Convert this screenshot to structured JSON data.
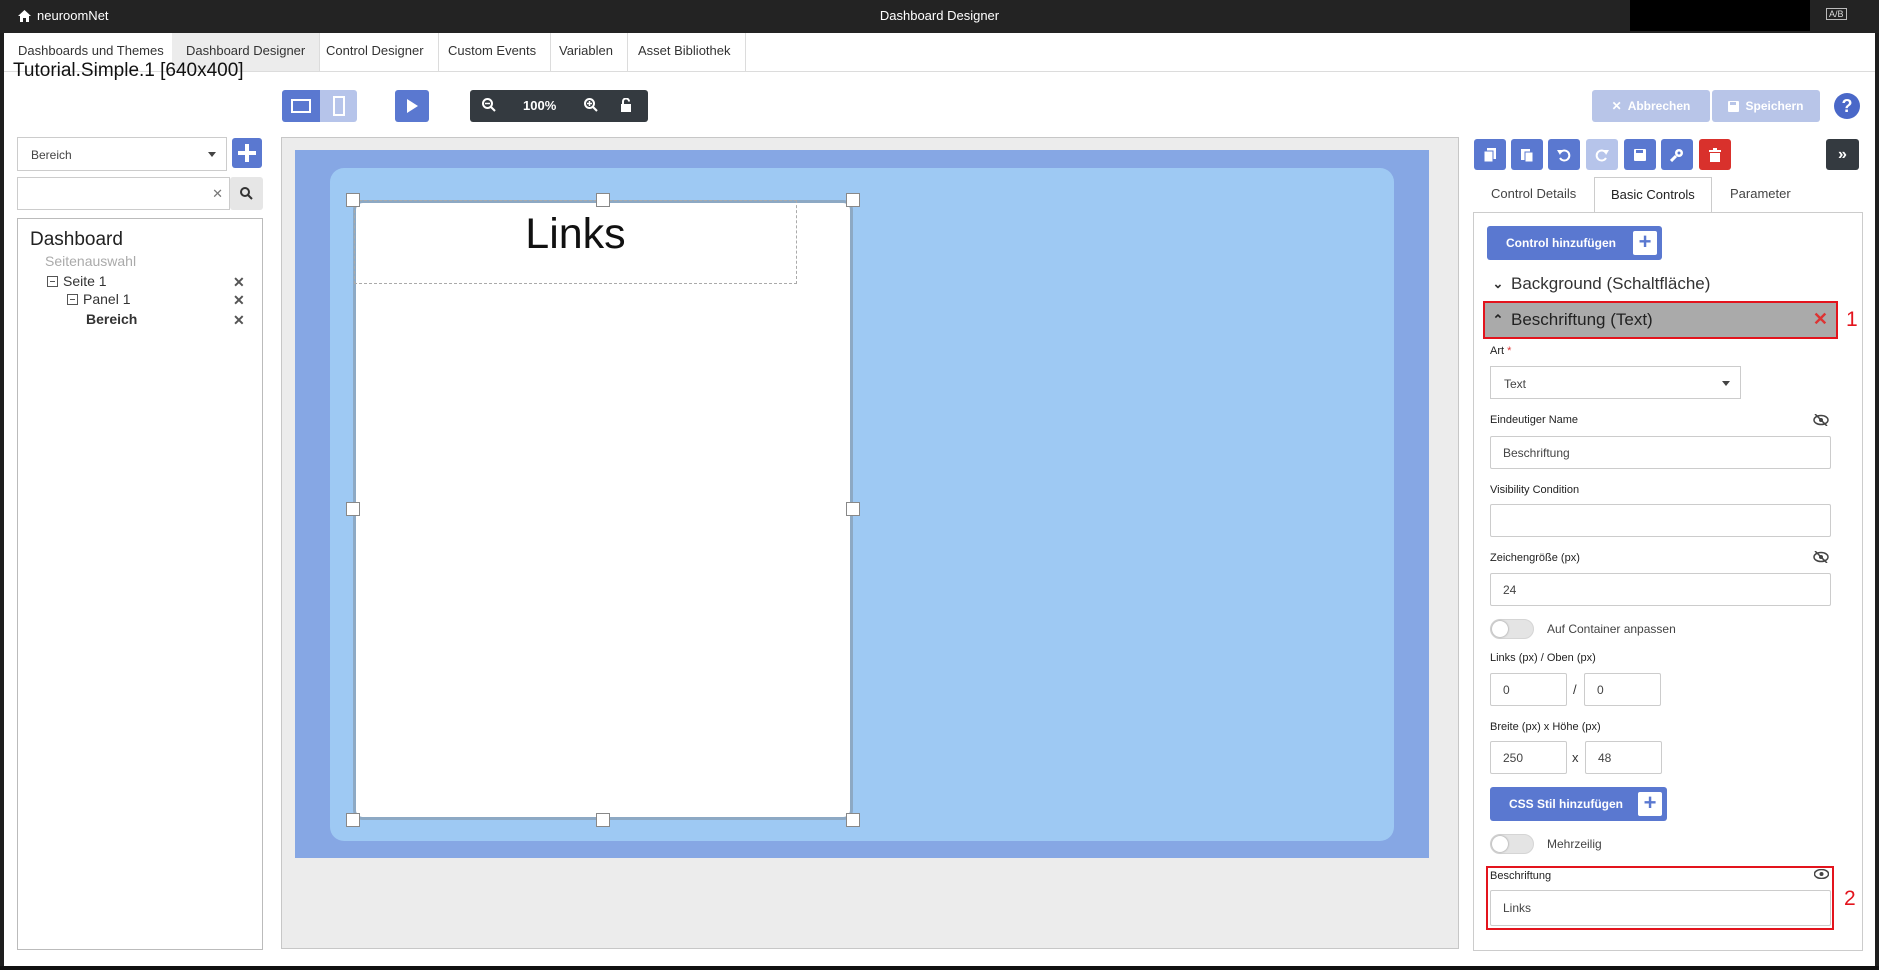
{
  "titlebar": {
    "brand": "neuroomNet",
    "title": "Dashboard Designer",
    "lang": "A/B"
  },
  "menu": {
    "tabs": [
      "Dashboards und Themes",
      "Dashboard Designer",
      "Control Designer",
      "Custom Events",
      "Variablen",
      "Asset Bibliothek"
    ],
    "active": 1
  },
  "document": {
    "title": "Tutorial.Simple.1 [640x400]"
  },
  "toolbar": {
    "zoom": "100%",
    "cancel_label": "Abbrechen",
    "save_label": "Speichern",
    "help": "?"
  },
  "left": {
    "type_select": "Bereich",
    "search_placeholder": "",
    "tree": {
      "root": "Dashboard",
      "page_select": "Seitenauswahl",
      "nodes": [
        {
          "label": "Seite 1"
        },
        {
          "label": "Panel 1"
        },
        {
          "label": "Bereich"
        }
      ]
    }
  },
  "canvas": {
    "label_text": "Links"
  },
  "right": {
    "tabs": [
      "Control Details",
      "Basic Controls",
      "Parameter"
    ],
    "active_tab": 1,
    "add_control": "Control hinzufügen",
    "sections": [
      {
        "title": "Background (Schaltfläche)",
        "open": false
      },
      {
        "title": "Beschriftung (Text)",
        "open": true
      }
    ],
    "fields": {
      "art_label": "Art",
      "art_value": "Text",
      "name_label": "Eindeutiger Name",
      "name_value": "Beschriftung",
      "visibility_label": "Visibility Condition",
      "visibility_value": "",
      "fontsize_label": "Zeichengröße (px)",
      "fontsize_value": "24",
      "fit_label": "Auf Container anpassen",
      "pos_label": "Links (px) / Oben (px)",
      "left_value": "0",
      "top_value": "0",
      "pos_sep": "/",
      "size_label": "Breite (px) x Höhe (px)",
      "width_value": "250",
      "height_value": "48",
      "size_sep": "x",
      "css_button": "CSS Stil hinzufügen",
      "multiline_label": "Mehrzeilig",
      "caption_label": "Beschriftung",
      "caption_value": "Links"
    },
    "annotations": [
      "1",
      "2"
    ]
  },
  "colors": {
    "accent": "#5a78d0",
    "danger": "#d9312c",
    "highlight": "#e3141d",
    "stage": "#86a7e4",
    "stage_inner": "#9ec9f3"
  }
}
